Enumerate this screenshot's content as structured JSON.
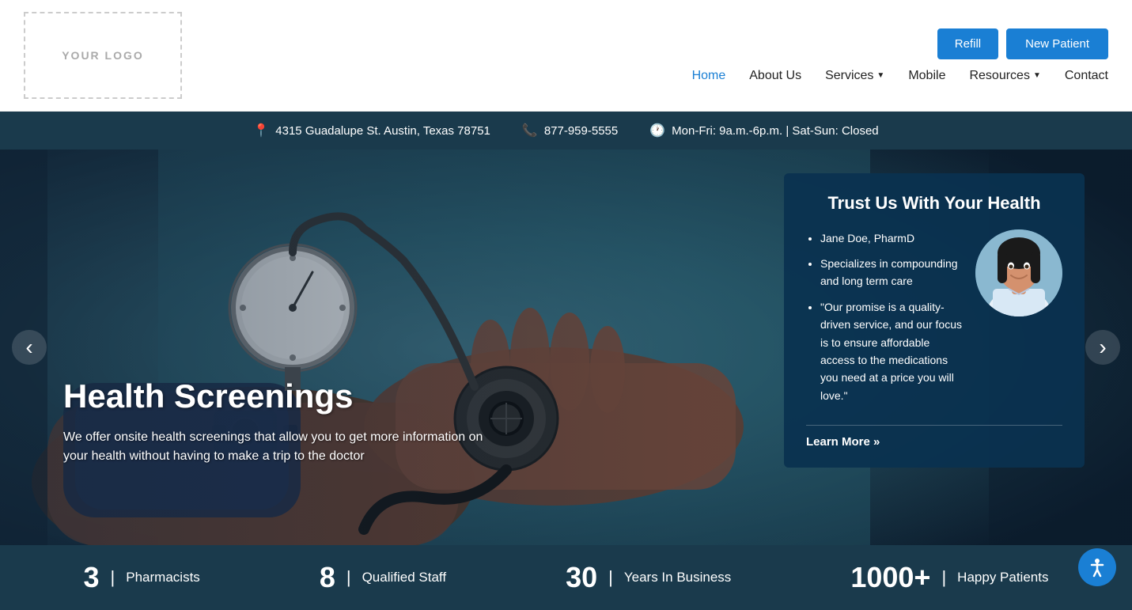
{
  "header": {
    "logo_text": "YOUR LOGO",
    "buttons": {
      "refill": "Refill",
      "new_patient": "New Patient"
    },
    "nav": [
      {
        "id": "home",
        "label": "Home",
        "active": true,
        "dropdown": false
      },
      {
        "id": "about",
        "label": "About Us",
        "active": false,
        "dropdown": false
      },
      {
        "id": "services",
        "label": "Services",
        "active": false,
        "dropdown": true
      },
      {
        "id": "mobile",
        "label": "Mobile",
        "active": false,
        "dropdown": false
      },
      {
        "id": "resources",
        "label": "Resources",
        "active": false,
        "dropdown": true
      },
      {
        "id": "contact",
        "label": "Contact",
        "active": false,
        "dropdown": false
      }
    ]
  },
  "info_bar": {
    "address": "4315 Guadalupe St. Austin, Texas 78751",
    "phone": "877-959-5555",
    "hours": "Mon-Fri: 9a.m.-6p.m. | Sat-Sun: Closed"
  },
  "hero": {
    "title": "Health Screenings",
    "description": "We offer onsite health screenings that allow you to get more information on your health without having to make a trip to the doctor"
  },
  "trust_card": {
    "title": "Trust Us With Your Health",
    "bullet1": "Jane Doe, PharmD",
    "bullet2": "Specializes in compounding and long term care",
    "bullet3": "\"Our promise is a quality-driven service, and our focus is to ensure affordable access to the medications you need at a price you will love.\"",
    "learn_more": "Learn More »"
  },
  "stats": [
    {
      "number": "3",
      "label": "Pharmacists"
    },
    {
      "number": "8",
      "label": "Qualified Staff"
    },
    {
      "number": "30",
      "label": "Years In Business"
    },
    {
      "number": "1000+",
      "label": "Happy Patients"
    }
  ],
  "carousel": {
    "prev": "‹",
    "next": "›"
  },
  "accessibility": {
    "label": "Accessibility"
  }
}
